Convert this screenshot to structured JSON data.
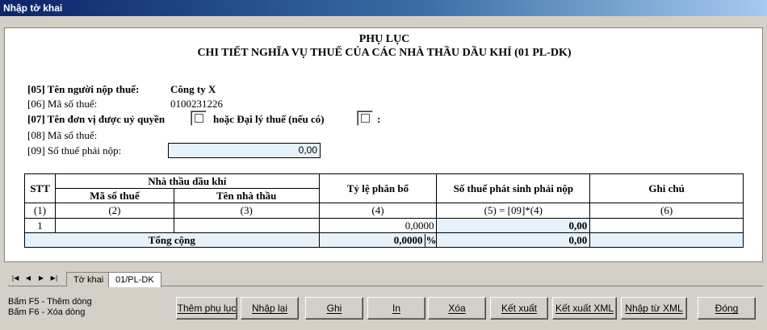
{
  "window": {
    "title": "Nhập tờ khai"
  },
  "header": {
    "line1": "PHỤ LỤC",
    "line2": "CHI TIẾT NGHĨA VỤ THUẾ CỦA CÁC NHÀ THẦU DẦU KHÍ (01 PL-DK)"
  },
  "fields": {
    "f05_label": "[05] Tên người nộp thuế:",
    "f05_value": "Công ty X",
    "f06_label": "[06] Mã số thuế:",
    "f06_value": "0100231226",
    "f07_label": "[07] Tên đơn vị được uỷ quyền",
    "f07_mid": "hoặc Đại lý thuế (nếu có)",
    "f07_end": ":",
    "f08_label": "[08] Mã số thuế:",
    "f09_label": "[09] Số thuế phải nộp:",
    "f09_value": "0,00"
  },
  "table": {
    "h_stt": "STT",
    "h_contractor": "Nhà thầu dầu khí",
    "h_tax_code": "Mã số thuế",
    "h_contractor_name": "Tên nhà thầu",
    "h_ratio": "Tỷ lệ phân bổ",
    "h_tax_payable": "Số thuế phát sinh phải nộp",
    "h_note": "Ghi chú",
    "idx1": "(1)",
    "idx2": "(2)",
    "idx3": "(3)",
    "idx4": "(4)",
    "idx5": "(5) = [09]*(4)",
    "idx6": "(6)",
    "rows": [
      {
        "stt": "1",
        "tax_code": "",
        "name": "",
        "ratio": "0,0000",
        "tax": "0,00",
        "note": ""
      }
    ],
    "total_label": "Tổng cộng",
    "total_ratio": "0,0000",
    "total_pct": "%",
    "total_tax": "0,00"
  },
  "tabs": [
    "Tờ khai",
    "01/PL-DK"
  ],
  "active_tab": "01/PL-DK",
  "hints": [
    "Bấm F5 - Thêm dòng",
    "Bấm F6 - Xóa dòng"
  ],
  "buttons": {
    "add_appendix": "Thêm phụ lục",
    "reenter": "Nhập lại",
    "save": "Ghi",
    "print": "In",
    "delete": "Xóa",
    "export": "Kết xuất",
    "export_xml": "Kết xuất XML",
    "import_xml": "Nhập từ XML",
    "close": "Đóng"
  }
}
